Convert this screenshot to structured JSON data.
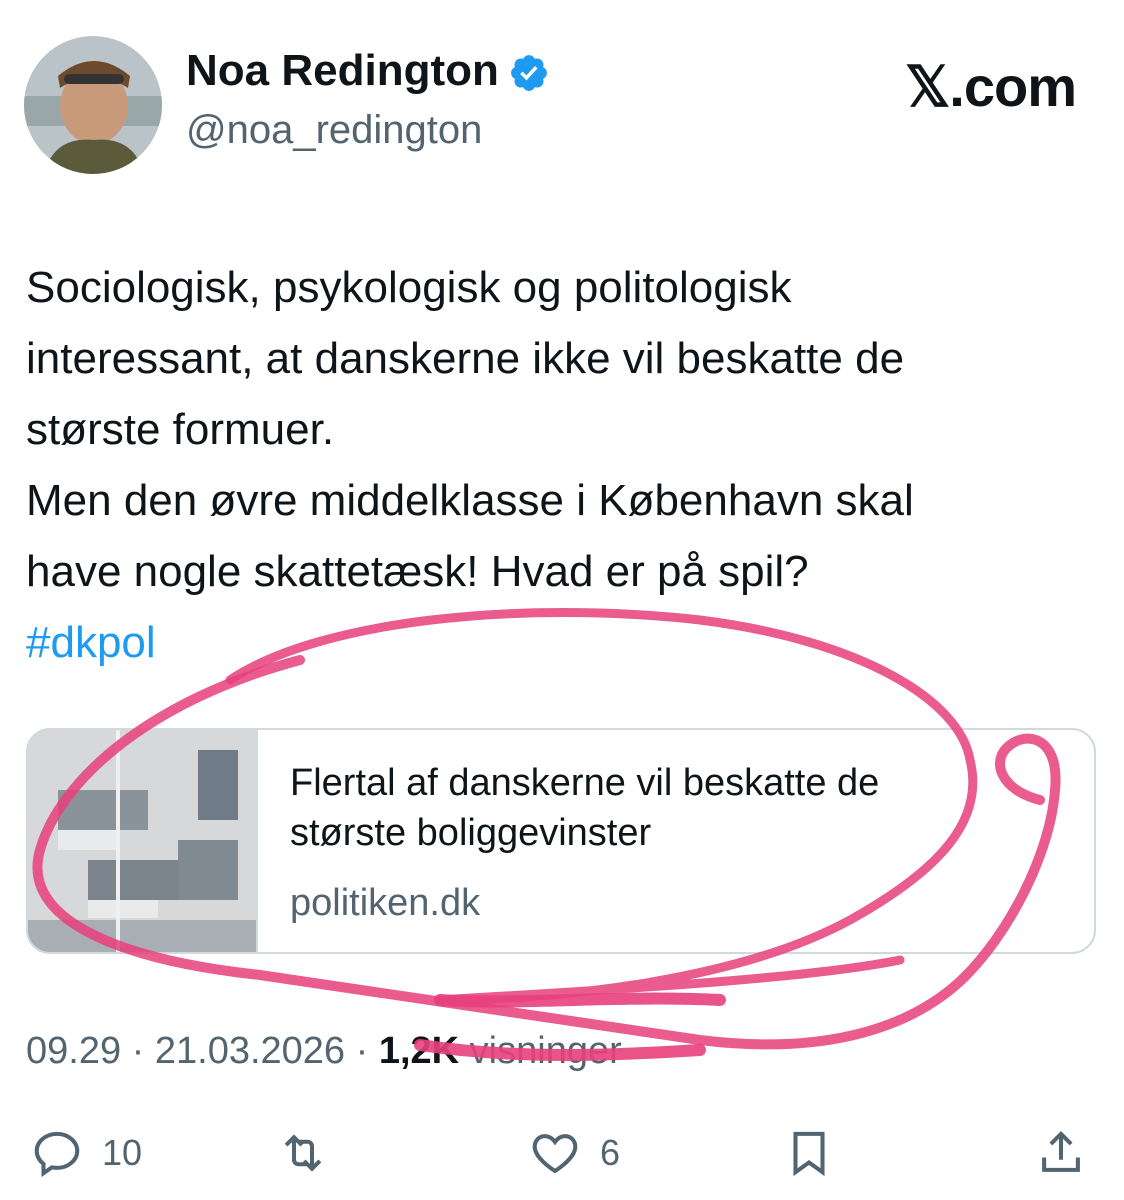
{
  "author": {
    "display_name": "Noa Redington",
    "handle": "@noa_redington",
    "verified_icon": "verified-badge-icon",
    "avatar": "profile-photo"
  },
  "site_label": "𝕏.com",
  "tweet": {
    "lines": [
      "Sociologisk, psykologisk og politologisk",
      "interessant, at danskerne ikke vil beskatte de",
      "største formuer.",
      "Men den øvre middelklasse i København skal",
      "have nogle skattetæsk! Hvad er på spil?"
    ],
    "hashtag": "#dkpol"
  },
  "link_card": {
    "title_lines": [
      "Flertal af danskerne vil beskatte de",
      "største boliggevinster"
    ],
    "domain": "politiken.dk",
    "thumbnail": "apartment-balconies-photo"
  },
  "meta": {
    "time": "09.29",
    "sep1": " · ",
    "date": "21.03.2026",
    "sep2": " · ",
    "views": "1,2K",
    "views_label": " visninger"
  },
  "actions": {
    "reply_count": "10",
    "like_count": "6"
  },
  "colors": {
    "accent": "#1d9bf0",
    "secondary_text": "#536471",
    "scribble": "#e8407a"
  }
}
